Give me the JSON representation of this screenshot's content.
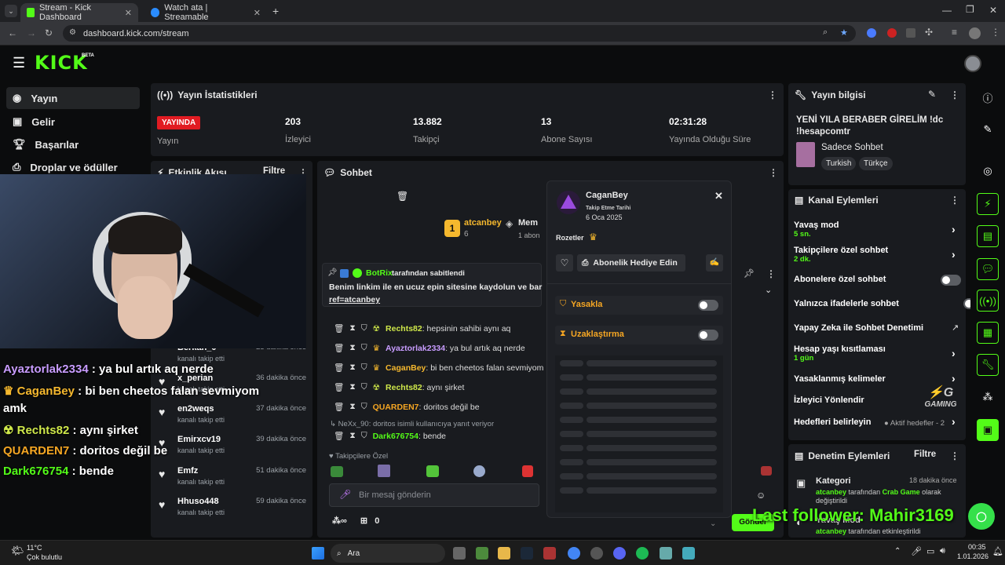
{
  "browser": {
    "tabs": [
      {
        "label": "Stream - Kick Dashboard"
      },
      {
        "label": "Watch ata | Streamable"
      }
    ],
    "url": "dashboard.kick.com/stream"
  },
  "brand": {
    "logo": "KICK",
    "beta": "BETA",
    "accent": "#53fc18"
  },
  "sidebar": {
    "items": [
      {
        "label": "Yayın",
        "icon": "broadcast-icon"
      },
      {
        "label": "Gelir",
        "icon": "money-icon"
      },
      {
        "label": "Başarılar",
        "icon": "trophy-icon"
      },
      {
        "label": "Droplar ve ödüller",
        "icon": "gift-icon"
      }
    ]
  },
  "stats": {
    "title": "Yayın İstatistikleri",
    "live_badge": "YAYINDA",
    "items": [
      {
        "value": "",
        "label": "Yayın"
      },
      {
        "value": "203",
        "label": "İzleyici"
      },
      {
        "value": "13.882",
        "label": "Takipçi"
      },
      {
        "value": "13",
        "label": "Abone Sayısı"
      },
      {
        "value": "02:31:28",
        "label": "Yayında Olduğu Süre"
      }
    ]
  },
  "stream_info": {
    "title": "Yayın bilgisi",
    "stream_title": "YENİ YILA BERABER GİRELİM !dc !hesapcomtr",
    "category": "Sadece Sohbet",
    "tags": [
      "Turkish",
      "Türkçe"
    ]
  },
  "activity": {
    "title": "Etkinlik Akışı",
    "filter": "Filtre",
    "items": [
      {
        "name": "Berkan_0",
        "sub": "kanalı takip etti",
        "time": "23 dakika önce"
      },
      {
        "name": "x_perian",
        "sub": "kanalı takip etti",
        "time": "36 dakika önce"
      },
      {
        "name": "en2weqs",
        "sub": "kanalı takip etti",
        "time": "37 dakika önce"
      },
      {
        "name": "Emirxcv19",
        "sub": "kanalı takip etti",
        "time": "39 dakika önce"
      },
      {
        "name": "Emfz",
        "sub": "kanalı takip etti",
        "time": "51 dakika önce"
      },
      {
        "name": "Hhuso448",
        "sub": "kanalı takip etti",
        "time": "59 dakika önce"
      }
    ]
  },
  "chat": {
    "title": "Sohbet",
    "streamer": "atcanbey",
    "streamer_count": "6",
    "mem_label": "Mem",
    "abon_label": "1 abon",
    "pinned_by": "BotRix",
    "pinned_suffix": "tarafından sabitlendi",
    "pinned_msg": "Benim linkim ile en ucuz epin sitesine kaydolun ve bar",
    "pinned_ref": "ref=atcanbey",
    "messages": [
      {
        "user": "Rechts82",
        "text": ": hepsinin sahibi aynı aq",
        "color": "#cfe84a"
      },
      {
        "user": "Ayaztorlak2334",
        "text": ": ya bul artık aq nerde",
        "color": "#c89cff"
      },
      {
        "user": "CaganBey",
        "text": ": bi ben cheetos falan sevmiyom",
        "color": "#f5b82e"
      },
      {
        "user": "Rechts82",
        "text": ": aynı şirket",
        "color": "#cfe84a"
      },
      {
        "user": "QUARDEN7",
        "text": ": doritos değil be",
        "color": "#f5a623"
      }
    ],
    "reply_note": "NeXx_90: doritos isimli kullanıcıya yanıt veriyor",
    "last_msg": {
      "user": "Dark676754",
      "text": ": bende",
      "color": "#53fc18"
    },
    "followers_only": "Takipçilere Özel",
    "input_placeholder": "Bir mesaj gönderin",
    "points": "0",
    "send": "Gönder"
  },
  "user_card": {
    "name": "CaganBey",
    "follow_label": "Takip Etme Tarihi",
    "follow_date": "6 Oca 2025",
    "badges_label": "Rozetler",
    "gift_button": "Abonelik Hediye Edin",
    "ban": "Yasakla",
    "timeout": "Uzaklaştırma"
  },
  "channel_actions": {
    "title": "Kanal Eylemleri",
    "items": [
      {
        "label": "Yavaş mod",
        "sub": "5 sn.",
        "type": "chevron"
      },
      {
        "label": "Takipçilere özel sohbet",
        "sub": "2 dk.",
        "type": "chevron"
      },
      {
        "label": "Abonelere özel sohbet",
        "sub": "",
        "type": "toggle"
      },
      {
        "label": "Yalnızca ifadelerle sohbet",
        "sub": "",
        "type": "toggle"
      },
      {
        "label": "Yapay Zeka ile Sohbet Denetimi",
        "sub": "",
        "type": "external"
      },
      {
        "label": "Hesap yaşı kısıtlaması",
        "sub": "1 gün",
        "type": "chevron"
      },
      {
        "label": "Yasaklanmış kelimeler",
        "sub": "",
        "type": "chevron"
      },
      {
        "label": "İzleyici Yönlendir",
        "sub": "",
        "type": "none"
      },
      {
        "label": "Hedefleri belirleyin",
        "sub": "",
        "type": "goals"
      }
    ],
    "goals_status": "Aktif hedefler - 2"
  },
  "moderation": {
    "title": "Denetim Eylemleri",
    "filter": "Filtre",
    "item_title": "Kategori",
    "item_time": "18 dakika önce",
    "item_user": "atcanbey",
    "item_mid": "tarafından",
    "item_value": "Crab Game",
    "item_suffix": "olarak değiştirildi",
    "item2_title": "Yavaş Mod",
    "item2_user": "atcanbey",
    "item2_suffix": "tarafından etkinleştirildi"
  },
  "overlay": {
    "lines": [
      {
        "user": "Ayaztorlak2334",
        "text": " : ya bul artık aq nerde",
        "color": "#c89cff"
      },
      {
        "user": "CaganBey",
        "text": " : bi ben cheetos falan sevmiyom",
        "color": "#f5b82e"
      },
      {
        "user": "",
        "text": "amk",
        "color": "#fff"
      },
      {
        "user": "Rechts82",
        "text": " : aynı şirket",
        "color": "#cfe84a"
      },
      {
        "user": "QUARDEN7",
        "text": " : doritos değil be",
        "color": "#f5a623"
      },
      {
        "user": "Dark676754",
        "text": " : bende",
        "color": "#53fc18"
      }
    ],
    "last_follower": "Last follower: Mahir3169",
    "gaming_logo": "GAMING"
  },
  "taskbar": {
    "weather_temp": "11°C",
    "weather_desc": "Çok bulutlu",
    "search": "Ara",
    "time": "00:35",
    "date": "1.01.2026"
  }
}
